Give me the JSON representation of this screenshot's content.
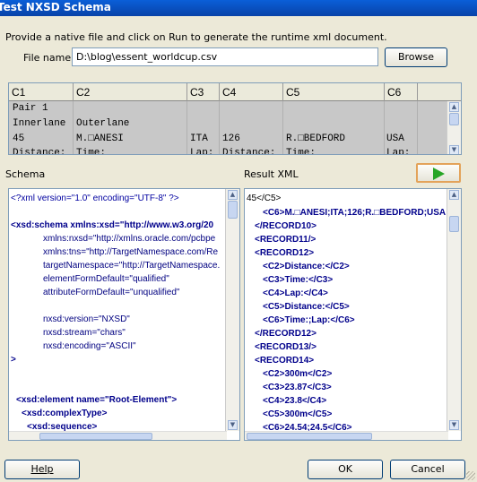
{
  "window": {
    "title": "Test NXSD Schema"
  },
  "instructions": "Provide a native file and click on Run to generate the runtime xml document.",
  "file": {
    "label": "File name:",
    "value": "D:\\blog\\essent_worldcup.csv",
    "browse_label": "Browse"
  },
  "grid": {
    "columns": [
      "C1",
      "C2",
      "C3",
      "C4",
      "C5",
      "C6"
    ],
    "rows": [
      [
        "Pair 1",
        "",
        "",
        "",
        "",
        ""
      ],
      [
        "Innerlane",
        "Outerlane",
        "",
        "",
        "",
        ""
      ],
      [
        "45",
        "M.□ANESI",
        "ITA",
        "126",
        "R.□BEDFORD",
        "USA"
      ],
      [
        "Distance:",
        "Time:",
        "Lap:",
        "Distance:",
        "Time:",
        "Lap:"
      ]
    ]
  },
  "schema": {
    "label": "Schema",
    "lines": [
      "<?xml version=\"1.0\" encoding=\"UTF-8\" ?>",
      "",
      "<xsd:schema xmlns:xsd=\"http://www.w3.org/20",
      "xmlns:nxsd=\"http://xmlns.oracle.com/pcbpe",
      "xmlns:tns=\"http://TargetNamespace.com/Re",
      "targetNamespace=\"http://TargetNamespace.",
      "elementFormDefault=\"qualified\"",
      "attributeFormDefault=\"unqualified\"",
      "",
      "nxsd:version=\"NXSD\"",
      "nxsd:stream=\"chars\"",
      "nxsd:encoding=\"ASCII\"",
      ">",
      "",
      "",
      "<xsd:element name=\"Root-Element\">",
      "<xsd:complexType>",
      "<xsd:sequence>"
    ]
  },
  "result": {
    "label": "Result XML",
    "lines": [
      "45</C5>",
      "<C6>M.□ANESI;ITA;126;R.□BEDFORD;USA",
      "</RECORD10>",
      "<RECORD11/>",
      "<RECORD12>",
      "<C2>Distance:</C2>",
      "<C3>Time:</C3>",
      "<C4>Lap:</C4>",
      "<C5>Distance:</C5>",
      "<C6>Time:;Lap:</C6>",
      "</RECORD12>",
      "<RECORD13/>",
      "<RECORD14>",
      "<C2>300m</C2>",
      "<C3>23.87</C3>",
      "<C4>23.8</C4>",
      "<C5>300m</C5>",
      "<C6>24.54;24.5</C6>"
    ]
  },
  "run_button": {
    "icon": "play-icon",
    "color": "#27a526"
  },
  "footer": {
    "help_label": "Help",
    "ok_label": "OK",
    "cancel_label": "Cancel"
  }
}
